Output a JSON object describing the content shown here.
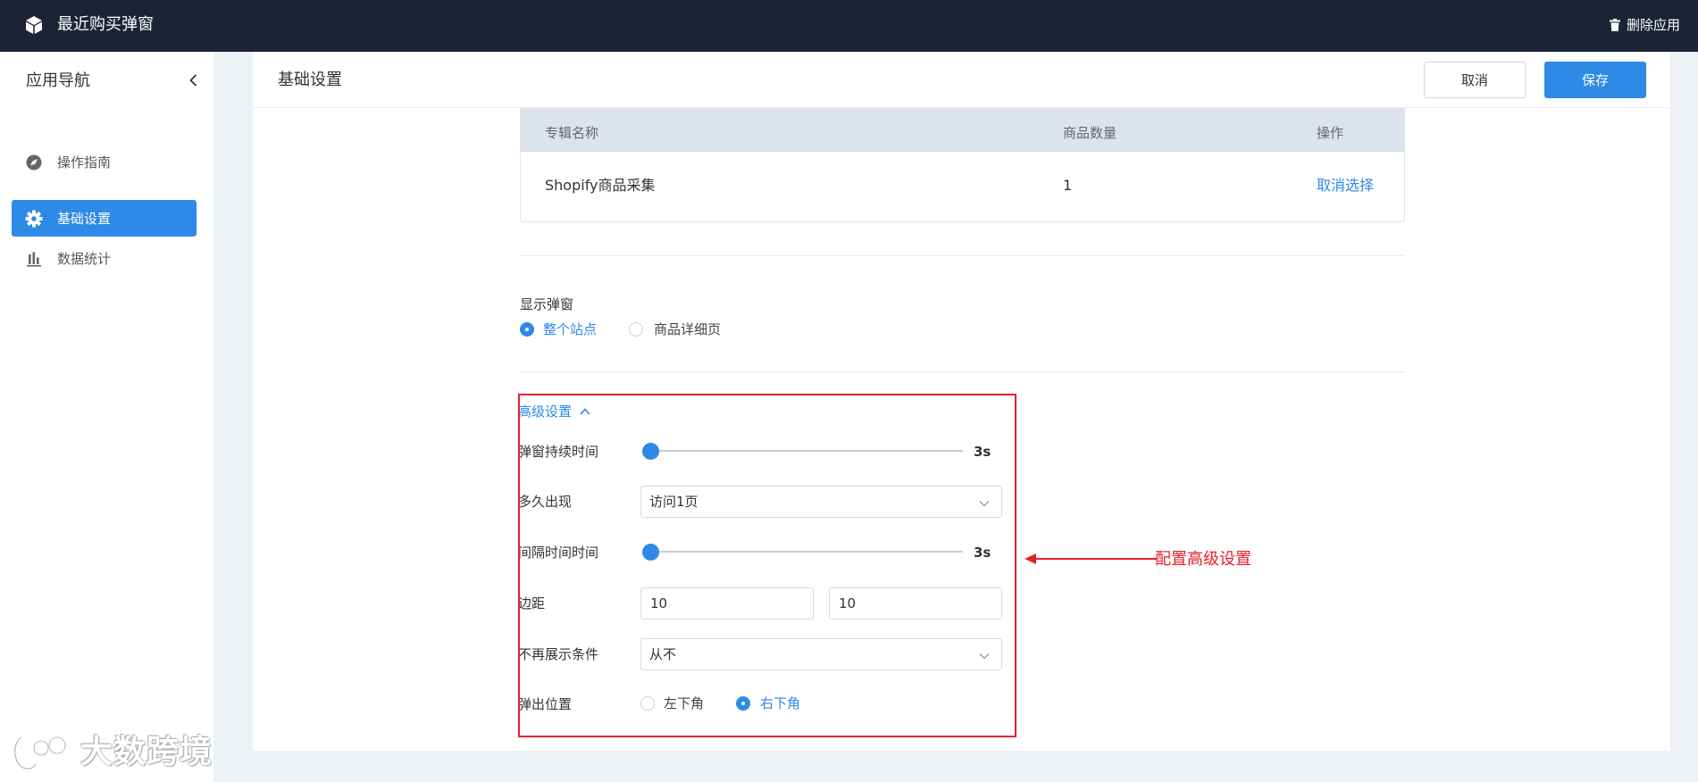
{
  "topbar": {
    "app_title": "最近购买弹窗",
    "delete_label": "删除应用"
  },
  "sidebar": {
    "title": "应用导航",
    "items": [
      {
        "label": "操作指南",
        "icon": "compass-icon",
        "active": false
      },
      {
        "label": "基础设置",
        "icon": "gear-icon",
        "active": true
      },
      {
        "label": "数据统计",
        "icon": "bar-chart-icon",
        "active": false
      }
    ]
  },
  "header": {
    "title": "基础设置",
    "cancel_label": "取消",
    "save_label": "保存"
  },
  "table": {
    "columns": [
      "专辑名称",
      "商品数量",
      "操作"
    ],
    "rows": [
      {
        "name": "Shopify商品采集",
        "count": "1",
        "action": "取消选择"
      }
    ]
  },
  "display": {
    "label": "显示弹窗",
    "options": [
      "整个站点",
      "商品详细页"
    ],
    "selected": "整个站点"
  },
  "advanced": {
    "toggle_label": "高级设置",
    "duration": {
      "label": "弹窗持续时间",
      "value_label": "3s",
      "value_seconds": 3
    },
    "frequency": {
      "label": "多久出现",
      "value": "访问1页"
    },
    "interval": {
      "label": "间隔时间时间",
      "value_label": "3s",
      "value_seconds": 3
    },
    "margin": {
      "label": "边距",
      "value1": "10",
      "value2": "10"
    },
    "stop_condition": {
      "label": "不再展示条件",
      "value": "从不"
    },
    "position": {
      "label": "弹出位置",
      "options": [
        "左下角",
        "右下角"
      ],
      "selected": "右下角"
    }
  },
  "annotation": {
    "text": "配置高级设置",
    "color": "#e8202a"
  },
  "watermark": {
    "text": "大数跨境"
  },
  "colors": {
    "topbar_bg": "#1b2335",
    "accent": "#2d8ae6",
    "page_bg": "#edf0f4"
  }
}
